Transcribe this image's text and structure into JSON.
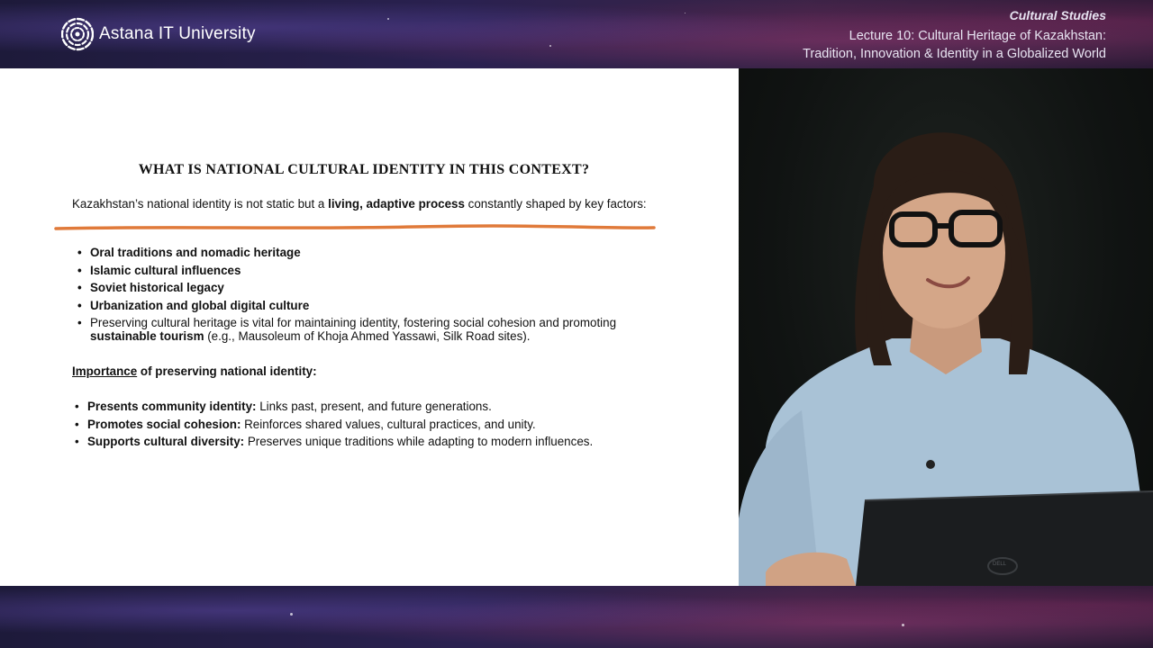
{
  "header": {
    "logo_name": "Astana IT University",
    "course": "Cultural Studies",
    "lecture_line1": "Lecture 10: Cultural Heritage of Kazakhstan:",
    "lecture_line2": "Tradition, Innovation & Identity in a Globalized World"
  },
  "slide": {
    "title": "WHAT IS NATIONAL CULTURAL IDENTITY IN THIS CONTEXT?",
    "intro": {
      "before": "Kazakhstan’s national identity is not static but a ",
      "bold": "living, adaptive process",
      "after": " constantly shaped by key factors:"
    },
    "factors": [
      "Oral traditions and nomadic heritage",
      "Islamic cultural influences",
      "Soviet historical legacy",
      "Urbanization and global digital culture"
    ],
    "preserving": {
      "before": "Preserving cultural heritage is vital for maintaining identity, fostering social cohesion and promoting ",
      "bold": "sustainable tourism",
      "after": " (e.g., Mausoleum of Khoja Ahmed Yassawi, Silk Road sites)."
    },
    "importance": {
      "underlined": "Importance",
      "rest": " of preserving national identity:"
    },
    "benefits": [
      {
        "bold": "Presents community identity:",
        "text": " Links past, present, and future generations."
      },
      {
        "bold": "Promotes social cohesion:",
        "text": " Reinforces shared values, cultural practices, and unity."
      },
      {
        "bold": "Supports cultural diversity:",
        "text": " Preserves unique traditions while adapting to modern influences."
      }
    ],
    "underline_color": "#e07a3a"
  },
  "video": {
    "laptop_brand": "DELL"
  },
  "colors": {
    "background": "#241d44",
    "slide_background": "#ffffff",
    "accent_orange": "#e07a3a"
  }
}
